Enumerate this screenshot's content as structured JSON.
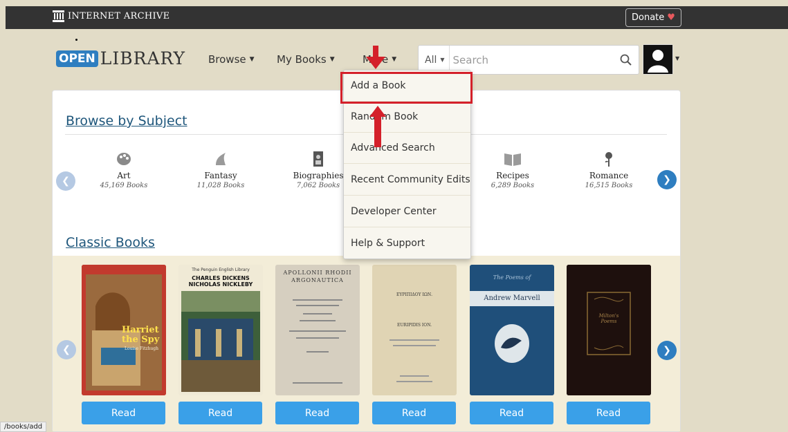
{
  "topbar": {
    "brand_label": "INTERNET ARCHIVE",
    "donate_label": "Donate"
  },
  "header": {
    "logo_open": "OPEN",
    "logo_library": "LIBRARY",
    "nav": [
      {
        "label": "Browse"
      },
      {
        "label": "My Books"
      },
      {
        "label": "More"
      }
    ],
    "search": {
      "scope": "All",
      "placeholder": "Search"
    }
  },
  "more_menu": {
    "items": [
      {
        "label": "Add a Book"
      },
      {
        "label": "Random Book"
      },
      {
        "label": "Advanced Search"
      },
      {
        "label": "Recent Community Edits"
      },
      {
        "label": "Developer Center"
      },
      {
        "label": "Help & Support"
      }
    ],
    "highlighted_index": 0
  },
  "browse_by_subject": {
    "title": "Browse by Subject",
    "subjects": [
      {
        "name": "Art",
        "count": "45,169 Books",
        "icon": "palette-icon"
      },
      {
        "name": "Fantasy",
        "count": "11,028 Books",
        "icon": "unicorn-icon"
      },
      {
        "name": "Biographies",
        "count": "7,062 Books",
        "icon": "portrait-icon"
      },
      {
        "name": "Recipes",
        "count": "6,289 Books",
        "icon": "recipe-book-icon"
      },
      {
        "name": "Romance",
        "count": "16,515 Books",
        "icon": "rose-icon"
      }
    ]
  },
  "classic_books": {
    "title": "Classic Books",
    "read_label": "Read",
    "books": [
      {
        "cover_title": "Harriet the Spy",
        "cover_author": "Louise Fitzhugh"
      },
      {
        "cover_title": "CHARLES DICKENS\nNICHOLAS NICKLEBY",
        "cover_series": "The Penguin English Library"
      },
      {
        "cover_title": "APOLLONII RHODII\nARGONAUTICA"
      },
      {
        "cover_title": "ΕΥΡΙΠΙΔΟΥ ΙΩΝ.\nEURIPIDIS ION."
      },
      {
        "cover_title": "Andrew Marvell",
        "cover_subtitle": "The Poems of"
      },
      {
        "cover_title": "Milton's Poems"
      }
    ]
  },
  "status_url": "/books/add",
  "colors": {
    "topbar": "#333333",
    "page_bg": "#e2dcc7",
    "link": "#1e567b",
    "read_button": "#3aa0e8",
    "highlight": "#d4202a"
  }
}
